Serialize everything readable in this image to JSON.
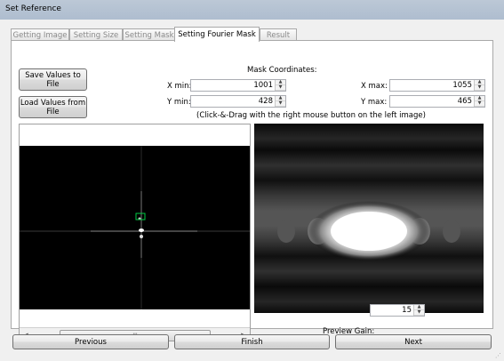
{
  "window": {
    "title": "Set Reference"
  },
  "tabs": [
    {
      "label": "Getting Image",
      "active": false
    },
    {
      "label": "Setting Size",
      "active": false
    },
    {
      "label": "Setting Mask",
      "active": false
    },
    {
      "label": "Setting Fourier Mask",
      "active": true
    },
    {
      "label": "Result",
      "active": false
    }
  ],
  "panel": {
    "save_button": "Save Values to File",
    "load_button": "Load Values from File",
    "mask_coordinates_label": "Mask Coordinates:",
    "xmin_label": "X min:",
    "xmin_value": "1001",
    "ymin_label": "Y min:",
    "ymin_value": "428",
    "xmax_label": "X max:",
    "xmax_value": "1055",
    "ymax_label": "Y max:",
    "ymax_value": "465",
    "hint": "(Click-&-Drag with the right mouse button on the left image)",
    "preview_gain_label": "Preview Gain:",
    "preview_gain_value": "15",
    "scroll_grip": "III"
  },
  "footer": {
    "previous_button": "Previous",
    "finish_button": "Finish",
    "next_button": "Next"
  },
  "colors": {
    "accent_selection": "#00cc44",
    "background": "#f0f0f0"
  }
}
